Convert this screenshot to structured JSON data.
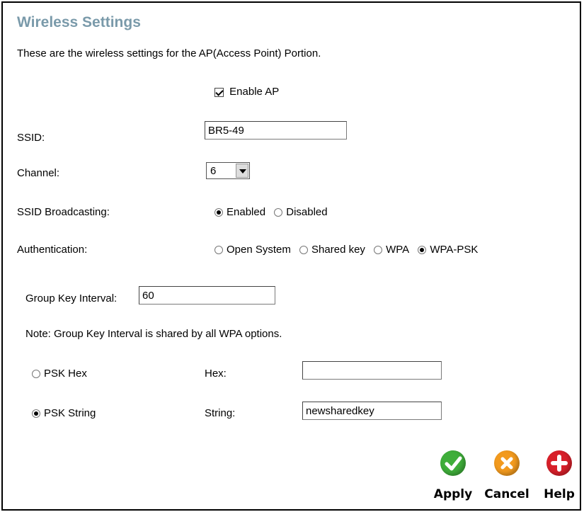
{
  "title": "Wireless Settings",
  "description": "These are the wireless settings for the AP(Access Point) Portion.",
  "enable_ap": {
    "label": "Enable AP",
    "checked": true
  },
  "ssid": {
    "label": "SSID:",
    "value": "BR5-49"
  },
  "channel": {
    "label": "Channel:",
    "value": "6"
  },
  "ssid_broadcasting": {
    "label": "SSID Broadcasting:",
    "options": [
      "Enabled",
      "Disabled"
    ],
    "selected": "Enabled"
  },
  "authentication": {
    "label": "Authentication:",
    "options": [
      "Open System",
      "Shared key",
      "WPA",
      "WPA-PSK"
    ],
    "selected": "WPA-PSK"
  },
  "group_key": {
    "label": "Group Key Interval:",
    "value": "60"
  },
  "note": "Note: Group Key Interval is shared by all WPA options.",
  "psk_hex": {
    "label": "PSK Hex",
    "field_label": "Hex:",
    "value": "",
    "selected": false
  },
  "psk_string": {
    "label": "PSK String",
    "field_label": "String:",
    "value": "newsharedkey",
    "selected": true
  },
  "buttons": {
    "apply": "Apply",
    "cancel": "Cancel",
    "help": "Help"
  },
  "colors": {
    "title": "#7a9aaa",
    "apply": "#3fae3a",
    "cancel": "#f29a1e",
    "help": "#d8202a"
  }
}
